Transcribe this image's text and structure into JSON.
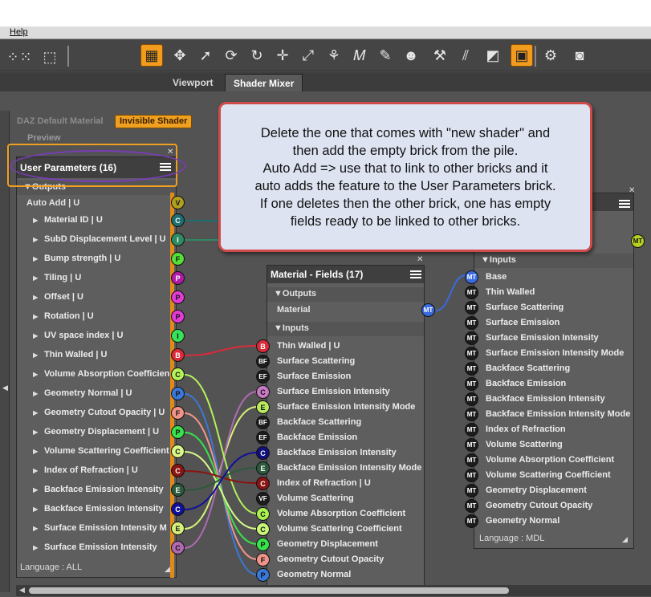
{
  "menu": {
    "help": "Help"
  },
  "tabs": [
    {
      "label": "Viewport",
      "active": false
    },
    {
      "label": "Shader Mixer",
      "active": true
    }
  ],
  "header": {
    "material_label": "DAZ Default Material",
    "shader_label": "Invisible Shader",
    "preview_label": "Preview"
  },
  "user_params": {
    "title": "User Parameters (16)",
    "outputs_label": "Outputs",
    "auto_add": "Auto Add  | U",
    "auto_add_port": "V",
    "footer": "Language : ALL",
    "items": [
      {
        "label": "Material ID  | U",
        "port": "C",
        "color": "#1f6e72"
      },
      {
        "label": "SubD Displacement Level  | U",
        "port": "I",
        "color": "#2f8a63"
      },
      {
        "label": "Bump strength  | U",
        "port": "F",
        "color": "#55e03a"
      },
      {
        "label": "Tiling  | U",
        "port": "P",
        "color": "#b21aa8"
      },
      {
        "label": "Offset  | U",
        "port": "P",
        "color": "#e23ad6"
      },
      {
        "label": "Rotation  | U",
        "port": "P",
        "color": "#e23ad6"
      },
      {
        "label": "UV space index  | U",
        "port": "I",
        "color": "#35e25a"
      },
      {
        "label": "Thin Walled  | U",
        "port": "B",
        "color": "#d92b3a"
      },
      {
        "label": "Volume Absorption Coefficient",
        "port": "C",
        "color": "#b4f25a"
      },
      {
        "label": "Geometry Normal  | U",
        "port": "P",
        "color": "#3a78d8"
      },
      {
        "label": "Geometry Cutout Opacity  | U",
        "port": "F",
        "color": "#f0948a"
      },
      {
        "label": "Geometry Displacement  | U",
        "port": "P",
        "color": "#38e24a"
      },
      {
        "label": "Volume Scattering Coefficient",
        "port": "C",
        "color": "#d8f88a"
      },
      {
        "label": "Index of Refraction  | U",
        "port": "C",
        "color": "#8a1414"
      },
      {
        "label": "Backface Emission Intensity",
        "port": "E",
        "color": "#2c5a3e"
      },
      {
        "label": "Backface Emission Intensity",
        "port": "C",
        "color": "#10109a"
      },
      {
        "label": "Surface Emission Intensity M",
        "port": "E",
        "color": "#d6f07a"
      },
      {
        "label": "Surface Emission Intensity",
        "port": "C",
        "color": "#b06ab2"
      }
    ]
  },
  "fields": {
    "title": "Material - Fields (17)",
    "outputs_label": "Outputs",
    "material_label": "Material",
    "material_port": "MT",
    "inputs_label": "Inputs",
    "items": [
      {
        "label": "Thin Walled  | U",
        "port": "B",
        "color": "#d92b3a"
      },
      {
        "label": "Surface Scattering",
        "port": "BF",
        "color": "#1c1c1c"
      },
      {
        "label": "Surface Emission",
        "port": "EF",
        "color": "#1c1c1c"
      },
      {
        "label": "Surface Emission Intensity",
        "port": "C",
        "color": "#c87ac4"
      },
      {
        "label": "Surface Emission Intensity Mode",
        "port": "E",
        "color": "#b8ea5e"
      },
      {
        "label": "Backface Scattering",
        "port": "BF",
        "color": "#1c1c1c"
      },
      {
        "label": "Backface Emission",
        "port": "EF",
        "color": "#1c1c1c"
      },
      {
        "label": "Backface Emission Intensity",
        "port": "C",
        "color": "#10107a"
      },
      {
        "label": "Backface Emission Intensity Mode",
        "port": "E",
        "color": "#2c5a3e"
      },
      {
        "label": "Index of Refraction  | U",
        "port": "C",
        "color": "#8a1414"
      },
      {
        "label": "Volume Scattering",
        "port": "VF",
        "color": "#1c1c1c"
      },
      {
        "label": "Volume Absorption Coefficient",
        "port": "C",
        "color": "#a8f050"
      },
      {
        "label": "Volume Scattering Coefficient",
        "port": "C",
        "color": "#c8f47a"
      },
      {
        "label": "Geometry Displacement",
        "port": "P",
        "color": "#38e24a"
      },
      {
        "label": "Geometry Cutout Opacity",
        "port": "F",
        "color": "#f0948a"
      },
      {
        "label": "Geometry Normal",
        "port": "P",
        "color": "#3a78d8"
      }
    ]
  },
  "mdl": {
    "inputs_label": "Inputs",
    "out_port": "MT",
    "footer": "Language : MDL",
    "items": [
      {
        "label": "Base",
        "port": "MT",
        "color": "#3a6ae0"
      },
      {
        "label": "Thin Walled",
        "port": "MT",
        "color": "#1c1c1c"
      },
      {
        "label": "Surface Scattering",
        "port": "MT",
        "color": "#1c1c1c"
      },
      {
        "label": "Surface Emission",
        "port": "MT",
        "color": "#1c1c1c"
      },
      {
        "label": "Surface Emission Intensity",
        "port": "MT",
        "color": "#1c1c1c"
      },
      {
        "label": "Surface Emission Intensity Mode",
        "port": "MT",
        "color": "#1c1c1c"
      },
      {
        "label": "Backface Scattering",
        "port": "MT",
        "color": "#1c1c1c"
      },
      {
        "label": "Backface Emission",
        "port": "MT",
        "color": "#1c1c1c"
      },
      {
        "label": "Backface Emission Intensity",
        "port": "MT",
        "color": "#1c1c1c"
      },
      {
        "label": "Backface Emission Intensity Mode",
        "port": "MT",
        "color": "#1c1c1c"
      },
      {
        "label": "Index of Refraction",
        "port": "MT",
        "color": "#1c1c1c"
      },
      {
        "label": "Volume Scattering",
        "port": "MT",
        "color": "#1c1c1c"
      },
      {
        "label": "Volume Absorption Coefficient",
        "port": "MT",
        "color": "#1c1c1c"
      },
      {
        "label": "Volume Scattering Coefficient",
        "port": "MT",
        "color": "#1c1c1c"
      },
      {
        "label": "Geometry Displacement",
        "port": "MT",
        "color": "#1c1c1c"
      },
      {
        "label": "Geometry Cutout Opacity",
        "port": "MT",
        "color": "#1c1c1c"
      },
      {
        "label": "Geometry Normal",
        "port": "MT",
        "color": "#1c1c1c"
      }
    ]
  },
  "callout": {
    "text": "Delete the one that comes with \"new shader\" and\nthen add the empty brick from the pile.\nAuto Add => use that to link to other bricks and it\nauto adds the feature to the User Parameters brick.\nIf one deletes then the other brick, one has empty\nfields ready to be linked to other bricks."
  },
  "colors": {
    "accent": "#f0a020",
    "highlight_ellipse": "#7a3cb8",
    "callout_border": "#d14a4a",
    "callout_bg": "#dde3f1"
  },
  "icons": [
    "move-icon",
    "rotate-icon",
    "pointer-icon",
    "orbit-icon",
    "refresh-icon",
    "translate-icon",
    "scale-icon",
    "pose-icon",
    "text-icon",
    "brush-icon",
    "figure-icon",
    "wand-icon",
    "node-icon",
    "geometry-icon",
    "camera-render-icon",
    "settings-pointer-icon",
    "camera-icon"
  ]
}
